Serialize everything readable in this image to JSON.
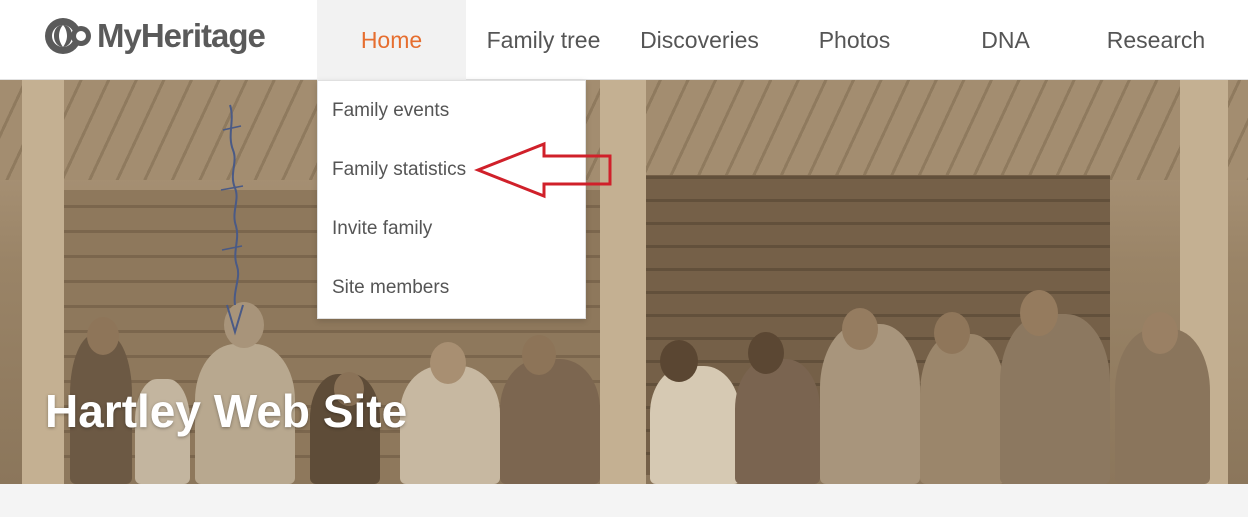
{
  "header": {
    "logo_text": "MyHeritage",
    "nav": [
      {
        "label": "Home",
        "active": true
      },
      {
        "label": "Family tree"
      },
      {
        "label": "Discoveries"
      },
      {
        "label": "Photos"
      },
      {
        "label": "DNA"
      },
      {
        "label": "Research"
      }
    ]
  },
  "dropdown": {
    "items": [
      {
        "label": "Family events"
      },
      {
        "label": "Family statistics"
      },
      {
        "label": "Invite family"
      },
      {
        "label": "Site members"
      }
    ]
  },
  "hero": {
    "title": "Hartley Web Site"
  },
  "colors": {
    "accent": "#e66e2f",
    "nav_text": "#555555",
    "annotation": "#d0202a",
    "logo": "#5a5a5a"
  },
  "icons": {
    "logo": "myheritage-logo-icon",
    "annotation": "red-arrow-icon"
  }
}
